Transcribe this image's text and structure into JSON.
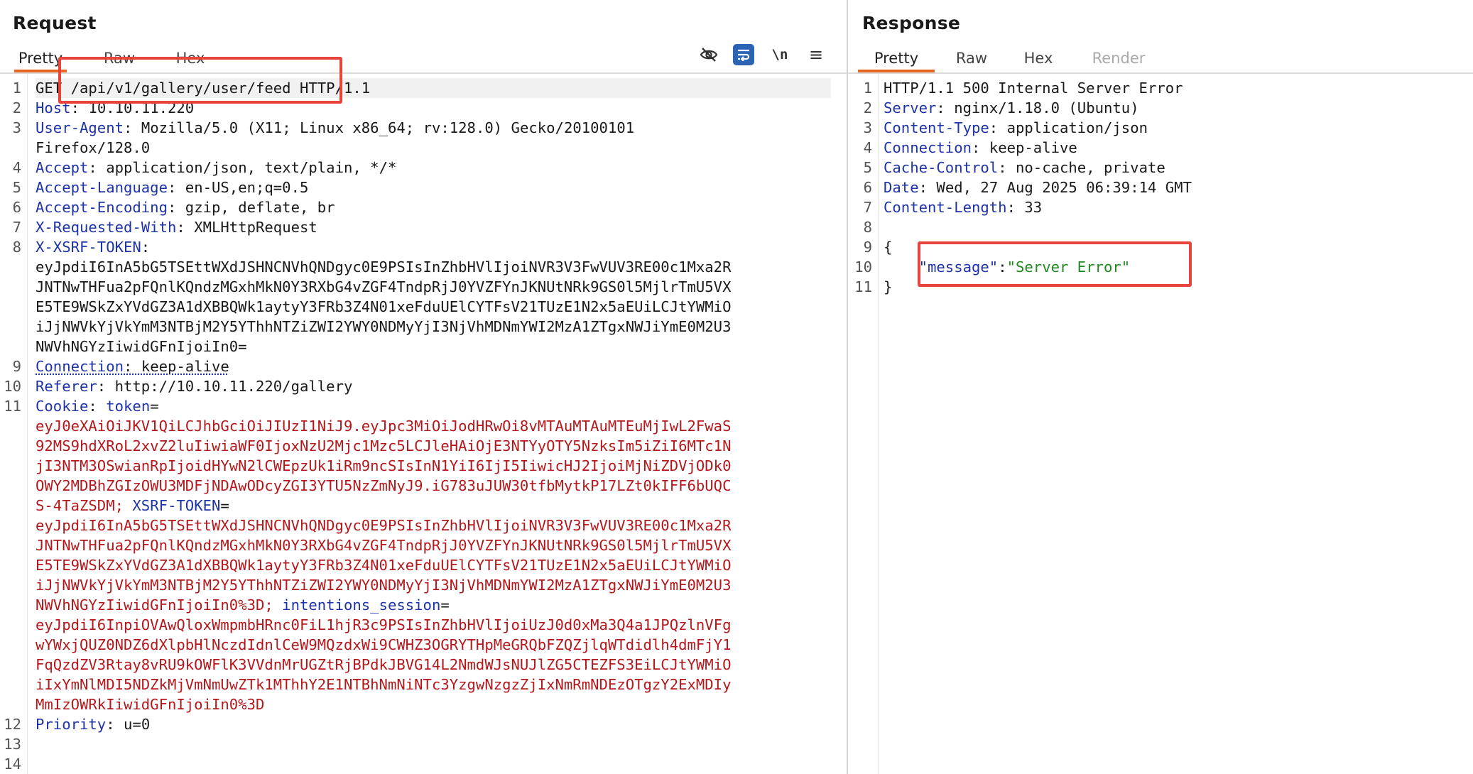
{
  "request": {
    "title": "Request",
    "tabs": [
      "Pretty",
      "Raw",
      "Hex"
    ],
    "active_tab": "Pretty",
    "toolbar_icons": [
      "hide-nonprinting-icon",
      "wrap-lines-icon",
      "newline-icon",
      "menu-icon"
    ],
    "newline_icon_text": "\\n",
    "menu_icon_text": "≡",
    "line_numbers": [
      "1",
      "2",
      "3",
      "4",
      "5",
      "6",
      "7",
      "8",
      "9",
      "10",
      "11",
      "12",
      "13",
      "14"
    ],
    "request_line": {
      "method": "GET",
      "path": "/api/v1/gallery/user/feed",
      "version": "HTTP/1.1"
    },
    "headers": [
      {
        "name": "Host",
        "value": "10.10.11.220"
      },
      {
        "name": "User-Agent",
        "value": "Mozilla/5.0 (X11; Linux x86_64; rv:128.0) Gecko/20100101",
        "cont": "Firefox/128.0"
      },
      {
        "name": "Accept",
        "value": "application/json, text/plain, */*"
      },
      {
        "name": "Accept-Language",
        "value": "en-US,en;q=0.5"
      },
      {
        "name": "Accept-Encoding",
        "value": "gzip, deflate, br"
      },
      {
        "name": "X-Requested-With",
        "value": "XMLHttpRequest"
      },
      {
        "name": "X-XSRF-TOKEN",
        "value": ""
      },
      {
        "name": "Connection",
        "value": "keep-alive"
      },
      {
        "name": "Referer",
        "value": "http://10.10.11.220/gallery"
      },
      {
        "name": "Cookie",
        "value": ""
      },
      {
        "name": "Priority",
        "value": "u=0"
      }
    ],
    "xsrf_token_lines": [
      "eyJpdiI6InA5bG5TSEttWXdJSHNCNVhQNDgyc0E9PSIsInZhbHVlIjoiNVR3V3FwVUV3RE00c1Mxa2R",
      "JNTNwTHFua2pFQnlKQndzMGxhMkN0Y3RXbG4vZGF4TndpRjJ0YVZFYnJKNUtNRk9GS0l5MjlrTmU5VX",
      "E5TE9WSkZxYVdGZ3A1dXBBQWk1aytyY3FRb3Z4N01xeFduUElCYTFsV21TUzE1N2x5aEUiLCJtYWMiO",
      "iJjNWVkYjVkYmM3NTBjM2Y5YThhNTZiZWI2YWY0NDMyYjI3NjVhMDNmYWI2MzA1ZTgxNWJiYmE0M2U3",
      "NWVhNGYzIiwidGFnIjoiIn0="
    ],
    "cookie": {
      "token_name": "token",
      "token_lines": [
        "eyJ0eXAiOiJKV1QiLCJhbGciOiJIUzI1NiJ9.eyJpc3MiOiJodHRwOi8vMTAuMTAuMTEuMjIwL2FwaS",
        "92MS9hdXRoL2xvZ2luIiwiaWF0IjoxNzU2Mjc1Mzc5LCJleHAiOjE3NTYyOTY5NzksIm5iZiI6MTc1N",
        "jI3NTM3OSwianRpIjoidHYwN2lCWEpzUk1iRm9ncSIsInN1YiI6IjI5IiwicHJ2IjoiMjNiZDVjODk0",
        "OWY2MDBhZGIzOWU3MDFjNDAwODcyZGI3YTU5NzZmNyJ9.iG783uJUW30tfbMytkP17LZt0kIFF6bUQC",
        "S-4TaZSDM;"
      ],
      "xsrf_name": "XSRF-TOKEN",
      "xsrf_lines": [
        "eyJpdiI6InA5bG5TSEttWXdJSHNCNVhQNDgyc0E9PSIsInZhbHVlIjoiNVR3V3FwVUV3RE00c1Mxa2R",
        "JNTNwTHFua2pFQnlKQndzMGxhMkN0Y3RXbG4vZGF4TndpRjJ0YVZFYnJKNUtNRk9GS0l5MjlrTmU5VX",
        "E5TE9WSkZxYVdGZ3A1dXBBQWk1aytyY3FRb3Z4N01xeFduUElCYTFsV21TUzE1N2x5aEUiLCJtYWMiO",
        "iJjNWVkYjVkYmM3NTBjM2Y5YThhNTZiZWI2YWY0NDMyYjI3NjVhMDNmYWI2MzA1ZTgxNWJiYmE0M2U3",
        "NWVhNGYzIiwidGFnIjoiIn0%3D;"
      ],
      "session_name": "intentions_session",
      "session_lines": [
        "eyJpdiI6InpiOVAwQloxWmpmbHRnc0FiL1hjR3c9PSIsInZhbHVlIjoiUzJ0d0xMa3Q4a1JPQzlnVFg",
        "wYWxjQUZ0NDZ6dXlpbHlNczdIdnlCeW9MQzdxWi9CWHZ3OGRYTHpMeGRQbFZQZjlqWTdidlh4dmFjY1",
        "FqQzdZV3Rtay8vRU9kOWFlK3VVdnMrUGZtRjBPdkJBVG14L2NmdWJsNUJlZG5CTEZFS3EiLCJtYWMiO",
        "iIxYmNlMDI5NDZkMjVmNmUwZTk1MThhY2E1NTBhNmNiNTc3YzgwNzgzZjIxNmRmNDEzOTgzY2ExMDIy",
        "MmIzOWRkIiwidGFnIjoiIn0%3D"
      ]
    }
  },
  "response": {
    "title": "Response",
    "tabs": [
      "Pretty",
      "Raw",
      "Hex",
      "Render"
    ],
    "active_tab": "Pretty",
    "line_numbers": [
      "1",
      "2",
      "3",
      "4",
      "5",
      "6",
      "7",
      "8",
      "9",
      "10",
      "11"
    ],
    "status_line": "HTTP/1.1 500 Internal Server Error",
    "headers": [
      {
        "name": "Server",
        "value": "nginx/1.18.0 (Ubuntu)"
      },
      {
        "name": "Content-Type",
        "value": "application/json"
      },
      {
        "name": "Connection",
        "value": "keep-alive"
      },
      {
        "name": "Cache-Control",
        "value": "no-cache, private"
      },
      {
        "name": "Date",
        "value": "Wed, 27 Aug 2025 06:39:14 GMT"
      },
      {
        "name": "Content-Length",
        "value": "33"
      }
    ],
    "body": {
      "open": "{",
      "key": "\"message\"",
      "sep": ":",
      "value": "\"Server Error\"",
      "close": "}"
    }
  },
  "colors": {
    "header_name": "#1f33a8",
    "cookie_value": "#b4181c",
    "json_string": "#1f8a1f",
    "active_tab_underline": "#e8661f",
    "highlight_box": "#e8443c"
  }
}
